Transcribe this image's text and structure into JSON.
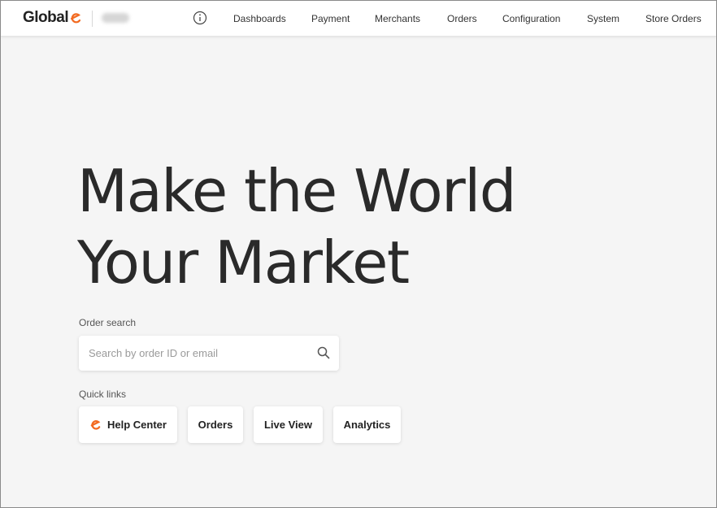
{
  "header": {
    "logo_text": "Global",
    "nav": [
      {
        "label": "Dashboards"
      },
      {
        "label": "Payment"
      },
      {
        "label": "Merchants"
      },
      {
        "label": "Orders"
      },
      {
        "label": "Configuration"
      },
      {
        "label": "System"
      },
      {
        "label": "Store Orders"
      }
    ],
    "icons": {
      "info": "info-icon",
      "logo_mark": "global-e-logo-icon"
    }
  },
  "hero": {
    "line1": "Make the World",
    "line2": "Your Market"
  },
  "order_search": {
    "label": "Order search",
    "placeholder": "Search by order ID or email",
    "value": "",
    "icon": "search-icon"
  },
  "quick_links": {
    "label": "Quick links",
    "items": [
      {
        "label": "Help Center",
        "icon": "global-e-logo-icon"
      },
      {
        "label": "Orders"
      },
      {
        "label": "Live View"
      },
      {
        "label": "Analytics"
      }
    ]
  },
  "colors": {
    "brand_accent": "#f26a21",
    "background": "#f5f5f5",
    "text": "#2a2a2a"
  }
}
